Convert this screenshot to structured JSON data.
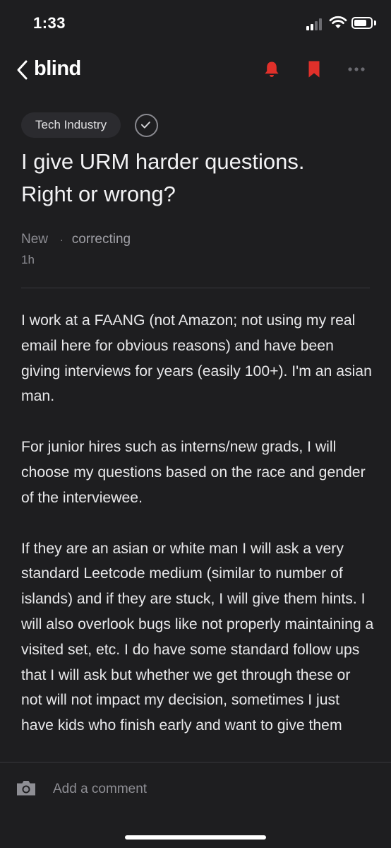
{
  "status_bar": {
    "time": "1:33"
  },
  "nav": {
    "logo": "blind",
    "icons": [
      "chevron-left-icon",
      "bell-icon",
      "bookmark-icon",
      "more-icon"
    ]
  },
  "colors": {
    "background": "#1e1e20",
    "accent_red": "#e0302a",
    "pill_background": "#2b2b2f",
    "muted_text": "#8e8e94"
  },
  "post": {
    "category": "Tech Industry",
    "title_line1": "I give URM harder questions.",
    "title_line2": "Right or wrong?",
    "company": "New",
    "separator": "·",
    "author": "correcting",
    "time_ago": "1h",
    "paragraphs": [
      "I work at a FAANG (not Amazon; not using my real email here for obvious reasons) and have been giving interviews for years (easily 100+). I'm an asian man.",
      "For junior hires such as interns/new grads, I will choose my questions based on the race and gender of the interviewee.",
      "If they are an asian or white man I will ask a very standard Leetcode medium (similar to number of islands) and if they are stuck, I will give them hints. I will also overlook bugs like not properly maintaining a visited set, etc. I do have some standard follow ups that I will ask but whether we get through these or not will not impact my decision, sometimes I just have kids who finish early and want to give them"
    ]
  },
  "comment_bar": {
    "placeholder": "Add a comment"
  }
}
